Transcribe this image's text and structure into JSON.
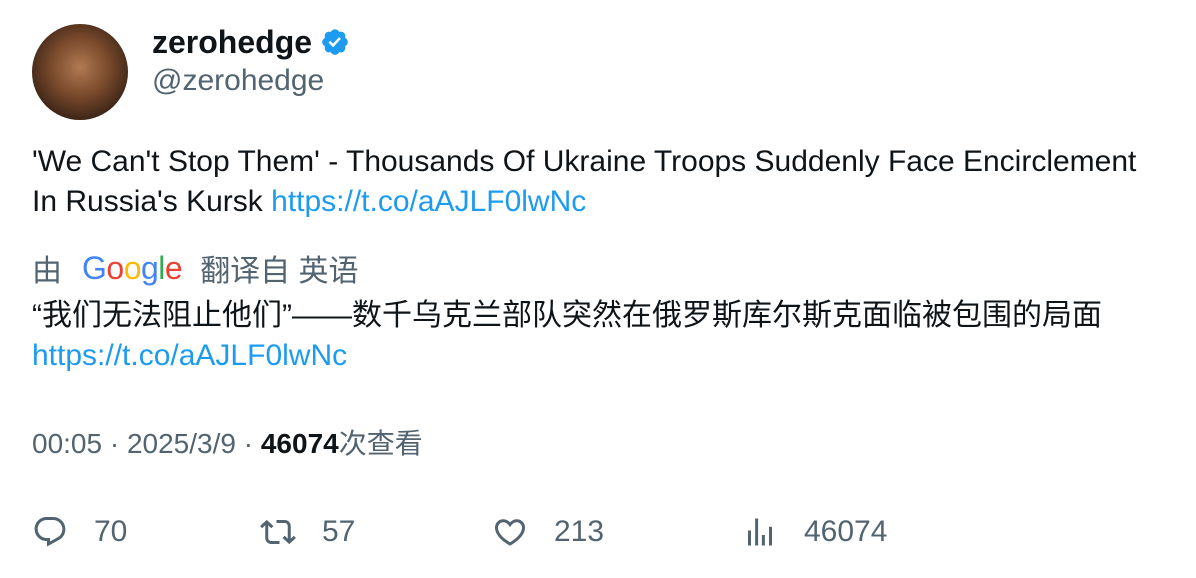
{
  "user": {
    "display_name": "zerohedge",
    "handle": "@zerohedge",
    "verified": true
  },
  "tweet": {
    "text": "'We Can't Stop Them' - Thousands Of Ukraine Troops Suddenly Face Encirclement In Russia's Kursk ",
    "link": "https://t.co/aAJLF0lwNc"
  },
  "translation": {
    "prefix": "由",
    "provider": "Google",
    "suffix": "翻译自 英语",
    "text": "“我们无法阻止他们”——数千乌克兰部队突然在俄罗斯库尔斯克面临被包围的局面 ",
    "link": "https://t.co/aAJLF0lwNc"
  },
  "meta": {
    "time": "00:05",
    "date": "2025/3/9",
    "views": "46074",
    "views_label": "次查看"
  },
  "actions": {
    "replies": "70",
    "retweets": "57",
    "likes": "213",
    "views": "46074"
  },
  "colors": {
    "link": "#1d9bf0",
    "verified": "#1d9bf0",
    "muted": "#536471",
    "text": "#0f1419"
  },
  "icons": [
    "verified-badge-icon",
    "reply-icon",
    "retweet-icon",
    "like-icon",
    "views-icon"
  ]
}
